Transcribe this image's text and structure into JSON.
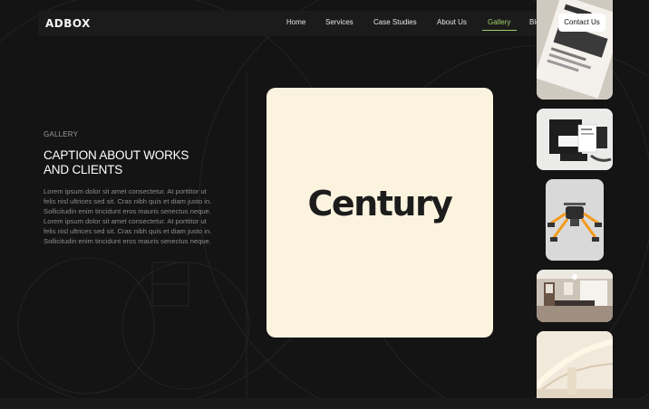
{
  "brand": {
    "logo": "ADBOX"
  },
  "nav": {
    "items": [
      {
        "label": "Home"
      },
      {
        "label": "Services"
      },
      {
        "label": "Case Studies"
      },
      {
        "label": "About Us"
      },
      {
        "label": "Gallery"
      },
      {
        "label": "Blog"
      }
    ],
    "active": "Gallery",
    "contact_label": "Contact Us"
  },
  "main": {
    "section_label": "GALLERY",
    "caption": "CAPTION ABOUT WORKS AND CLIENTS",
    "body": "Lorem ipsum dolor sit amet consectetur. At porttitor ut felis nisl ultrices sed sit. Cras nibh quis et diam justo in. Sollicitudin enim tincidunt eros mauris senectus neque. Lorem ipsum dolor sit amet consectetur. At porttitor ut felis nisl ultrices sed sit. Cras nibh quis et diam justo in. Sollicitudin enim tincidunt eros mauris senectus neque."
  },
  "feature": {
    "wordmark": "Century"
  },
  "colors": {
    "background": "#141414",
    "accent": "#9fd26a",
    "feature_card": "#fcf3df"
  }
}
